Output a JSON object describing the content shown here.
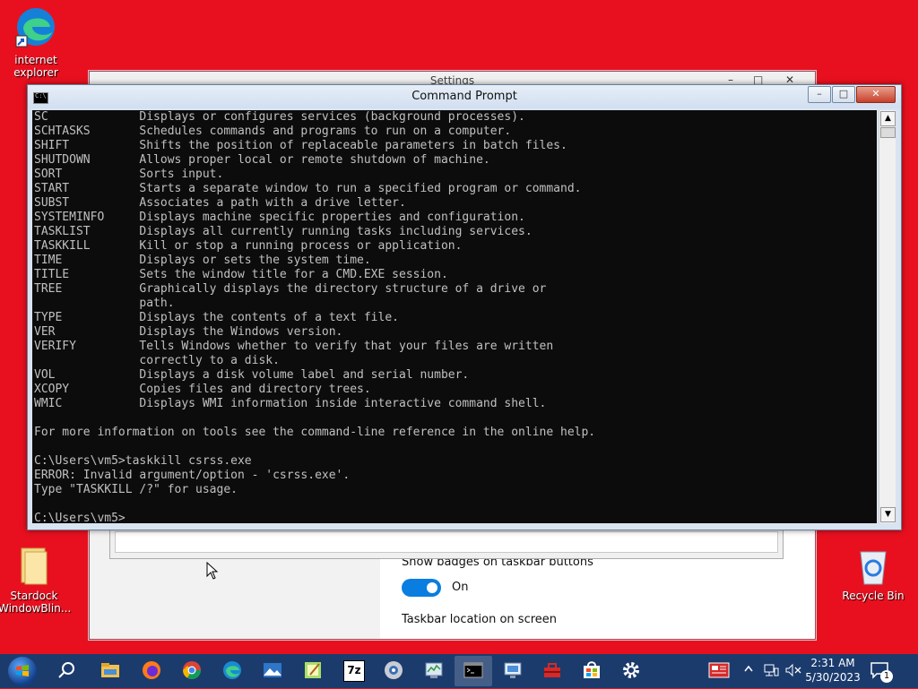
{
  "desktop": {
    "icons": [
      {
        "label": "internet\nexplorer"
      },
      {
        "label": "Stardock\nWindowBlin..."
      },
      {
        "label": "Recycle Bin"
      }
    ]
  },
  "settings_window": {
    "title": "Settings",
    "show_badges_label": "Show badges on taskbar buttons",
    "toggle_state": "On",
    "taskbar_location_label": "Taskbar location on screen"
  },
  "cmd": {
    "title": "Command Prompt",
    "minimize": "–",
    "maximize": "□",
    "close": "✕",
    "lines": [
      "SC             Displays or configures services (background processes).",
      "SCHTASKS       Schedules commands and programs to run on a computer.",
      "SHIFT          Shifts the position of replaceable parameters in batch files.",
      "SHUTDOWN       Allows proper local or remote shutdown of machine.",
      "SORT           Sorts input.",
      "START          Starts a separate window to run a specified program or command.",
      "SUBST          Associates a path with a drive letter.",
      "SYSTEMINFO     Displays machine specific properties and configuration.",
      "TASKLIST       Displays all currently running tasks including services.",
      "TASKKILL       Kill or stop a running process or application.",
      "TIME           Displays or sets the system time.",
      "TITLE          Sets the window title for a CMD.EXE session.",
      "TREE           Graphically displays the directory structure of a drive or",
      "               path.",
      "TYPE           Displays the contents of a text file.",
      "VER            Displays the Windows version.",
      "VERIFY         Tells Windows whether to verify that your files are written",
      "               correctly to a disk.",
      "VOL            Displays a disk volume label and serial number.",
      "XCOPY          Copies files and directory trees.",
      "WMIC           Displays WMI information inside interactive command shell.",
      "",
      "For more information on tools see the command-line reference in the online help.",
      "",
      "C:\\Users\\vm5>taskkill csrss.exe",
      "ERROR: Invalid argument/option - 'csrss.exe'.",
      "Type \"TASKKILL /?\" for usage.",
      "",
      "C:\\Users\\vm5>"
    ]
  },
  "taskbar": {
    "apps": [
      {
        "name": "file-explorer"
      },
      {
        "name": "firefox"
      },
      {
        "name": "chrome"
      },
      {
        "name": "edge"
      },
      {
        "name": "photos"
      },
      {
        "name": "notepad"
      },
      {
        "name": "7zip",
        "text": "7z"
      },
      {
        "name": "disk-tool"
      },
      {
        "name": "task-manager"
      },
      {
        "name": "command-prompt"
      },
      {
        "name": "remote-desktop"
      },
      {
        "name": "toolbox"
      },
      {
        "name": "store"
      },
      {
        "name": "settings"
      }
    ],
    "time": "2:31 AM",
    "date": "5/30/2023",
    "notification_count": "1"
  },
  "colors": {
    "desktop_bg": "#e8101f",
    "taskbar_bg": "#1b3b6d",
    "console_bg": "#0c0c0c",
    "console_fg": "#c0c0c0",
    "toggle_on": "#0a7de0"
  }
}
